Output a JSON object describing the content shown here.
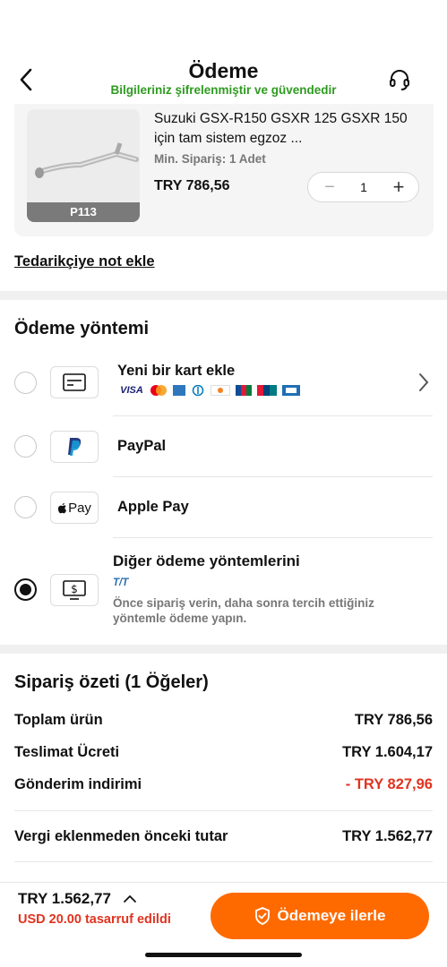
{
  "header": {
    "title": "Ödeme",
    "subtitle": "Bilgileriniz şifrelenmiştir ve güvendedir"
  },
  "product": {
    "title": "Suzuki GSX-R150 GSXR 125 GSXR 150 için tam sistem egzoz ...",
    "code": "P113",
    "min_order": "Min. Sipariş: 1 Adet",
    "price": "TRY 786,56",
    "quantity": "1",
    "minus": "−",
    "plus": "+"
  },
  "note_link": "Tedarikçiye not ekle",
  "payment": {
    "section_title": "Ödeme yöntemi",
    "methods": [
      {
        "label": "Yeni bir kart ekle",
        "icon": "credit-card-icon",
        "selected": false
      },
      {
        "label": "PayPal",
        "icon": "paypal-icon",
        "selected": false
      },
      {
        "label": "Apple Pay",
        "icon": "apple-pay-icon",
        "selected": false
      },
      {
        "label": "Diğer ödeme yöntemlerini",
        "icon": "dollar-screen-icon",
        "selected": true,
        "badge": "T/T",
        "description": "Önce sipariş verin, daha sonra tercih ettiğiniz yöntemle ödeme yapın."
      }
    ],
    "card_brands": [
      "VISA",
      "mastercard",
      "amex",
      "diners",
      "discover",
      "jcb",
      "unionpay",
      "cartes-bancaires"
    ],
    "apple_pay_text": "Pay"
  },
  "summary": {
    "title": "Sipariş özeti (1 Öğeler)",
    "rows": [
      {
        "label": "Toplam ürün",
        "value": "TRY 786,56"
      },
      {
        "label": "Teslimat Ücreti",
        "value": "TRY 1.604,17"
      },
      {
        "label": "Gönderim indirimi",
        "value": "- TRY 827,96"
      },
      {
        "label": "Vergi eklenmeden önceki tutar",
        "value": "TRY 1.562,77"
      }
    ]
  },
  "footer": {
    "total": "TRY 1.562,77",
    "savings": "USD 20.00 tasarruf edildi",
    "checkout_label": "Ödemeye ilerle"
  },
  "colors": {
    "accent": "#ff6a00",
    "secure_green": "#2e9b1f",
    "discount_red": "#e0331f"
  }
}
